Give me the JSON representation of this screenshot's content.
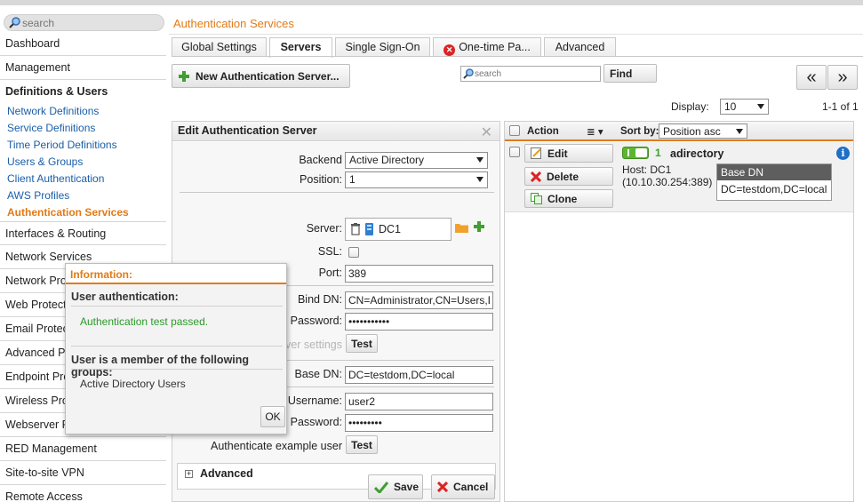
{
  "search": {
    "placeholder": "search"
  },
  "page_title": "Authentication Services",
  "sidebar": {
    "items": [
      {
        "label": "Dashboard"
      },
      {
        "label": "Management"
      },
      {
        "label": "Definitions & Users"
      },
      {
        "label": "Interfaces & Routing"
      },
      {
        "label": "Network Services"
      },
      {
        "label": "Network Protection"
      },
      {
        "label": "Web Protection"
      },
      {
        "label": "Email Protection"
      },
      {
        "label": "Advanced Protection"
      },
      {
        "label": "Endpoint Protection"
      },
      {
        "label": "Wireless Protection"
      },
      {
        "label": "Webserver Protection"
      },
      {
        "label": "RED Management"
      },
      {
        "label": "Site-to-site VPN"
      },
      {
        "label": "Remote Access"
      }
    ],
    "sub_items": [
      {
        "label": "Network Definitions"
      },
      {
        "label": "Service Definitions"
      },
      {
        "label": "Time Period Definitions"
      },
      {
        "label": "Users & Groups"
      },
      {
        "label": "Client Authentication"
      },
      {
        "label": "AWS Profiles"
      },
      {
        "label": "Authentication Services"
      }
    ]
  },
  "tabs": [
    {
      "label": "Global Settings"
    },
    {
      "label": "Servers"
    },
    {
      "label": "Single Sign-On"
    },
    {
      "label": "One-time Pa..."
    },
    {
      "label": "Advanced"
    }
  ],
  "toolbar": {
    "new_server_label": "New Authentication Server...",
    "search_placeholder": "search",
    "find_label": "Find",
    "prev_label": "«",
    "next_label": "»",
    "display_label": "Display:",
    "display_value": "10",
    "paging": "1-1 of 1"
  },
  "edit_panel": {
    "title": "Edit Authentication Server",
    "backend_label": "Backend",
    "backend_value": "Active Directory",
    "position_label": "Position:",
    "position_value": "1",
    "server_label": "Server:",
    "server_value": "DC1",
    "ssl_label": "SSL:",
    "port_label": "Port:",
    "port_value": "389",
    "binddn_label": "Bind DN:",
    "binddn_value": "CN=Administrator,CN=Users,DC=testdom,DC=local",
    "password_label": "Password:",
    "password_value": "•••••••••••",
    "test_settings_label": "Test server settings",
    "test_label": "Test",
    "basedn_label": "Base DN:",
    "basedn_value": "DC=testdom,DC=local",
    "username_label": "Username:",
    "username_value": "user2",
    "password2_label": "Password:",
    "password2_value": "•••••••••",
    "test_user_label": "Authenticate example user",
    "test2_label": "Test",
    "advanced_label": "Advanced",
    "save_label": "Save",
    "cancel_label": "Cancel"
  },
  "list_panel": {
    "action_header": "Action",
    "sortby_label": "Sort by:",
    "sortby_value": "Position asc",
    "edit_label": "Edit",
    "delete_label": "Delete",
    "clone_label": "Clone",
    "position": "1",
    "name": "adirectory",
    "host": "Host: DC1",
    "address": "(10.10.30.254:389)",
    "basedn_header": "Base DN",
    "basedn_value": "DC=testdom,DC=local"
  },
  "modal": {
    "title": "Information:",
    "section1": "User authentication:",
    "result": "Authentication test passed.",
    "section2": "User is a member of the following groups:",
    "group": "Active Directory Users",
    "ok_label": "OK"
  },
  "colors": {
    "accent": "#e07b16",
    "link": "#1a5ea8",
    "success": "#2a9a2a"
  }
}
